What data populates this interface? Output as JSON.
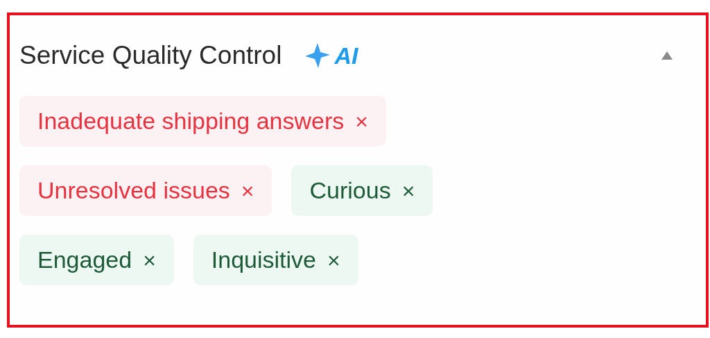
{
  "panel": {
    "title": "Service Quality Control",
    "badge": "AI",
    "expanded": true,
    "tags": [
      {
        "label": "Inadequate shipping answers",
        "kind": "negative",
        "remove": "×"
      },
      {
        "label": "Unresolved issues",
        "kind": "negative",
        "remove": "×"
      },
      {
        "label": "Curious",
        "kind": "positive",
        "remove": "×"
      },
      {
        "label": "Engaged",
        "kind": "positive",
        "remove": "×"
      },
      {
        "label": "Inquisitive",
        "kind": "positive",
        "remove": "×"
      }
    ]
  }
}
